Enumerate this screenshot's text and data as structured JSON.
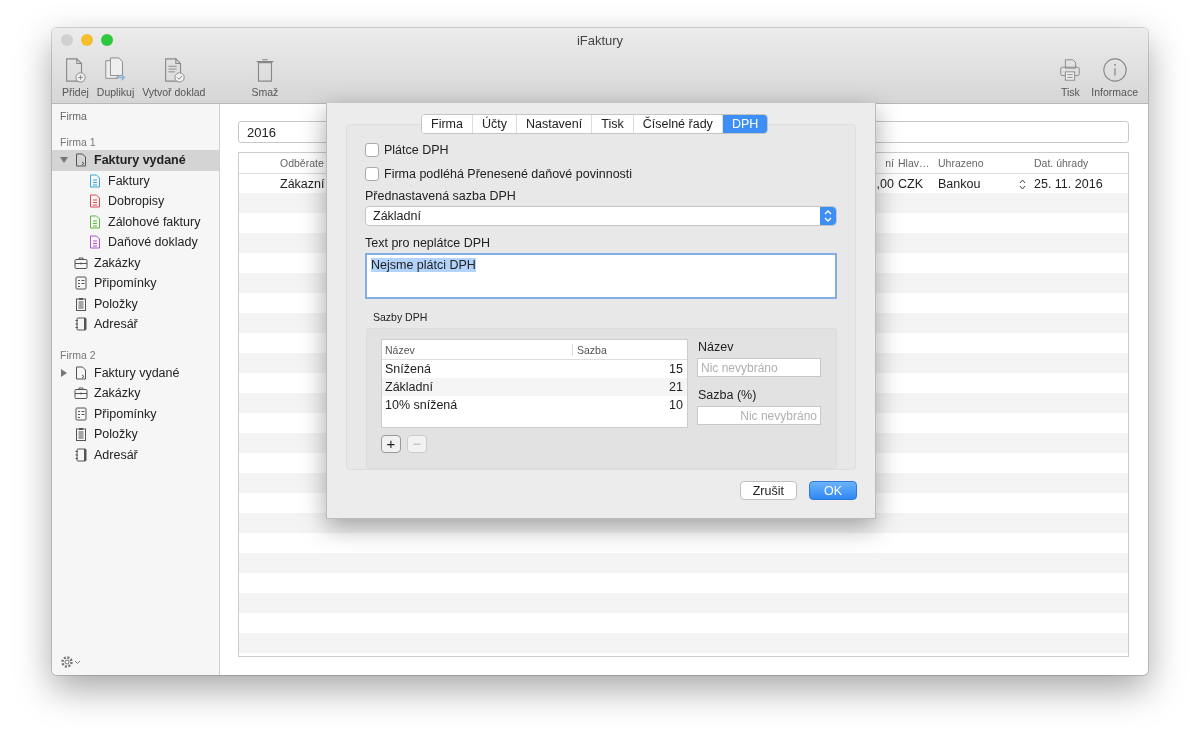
{
  "window": {
    "title": "iFaktury"
  },
  "toolbar": {
    "left": [
      {
        "label": "Přidej",
        "kind": "add"
      },
      {
        "label": "Duplikuj",
        "kind": "duplicate"
      },
      {
        "label": "Vytvoř doklad",
        "kind": "create"
      },
      {
        "label": "Smaž",
        "kind": "delete"
      }
    ],
    "right": [
      {
        "label": "Tisk",
        "kind": "print"
      },
      {
        "label": "Informace",
        "kind": "info"
      }
    ]
  },
  "sidebar": {
    "header": "Firma",
    "groups": [
      {
        "title": "Firma 1",
        "items": [
          {
            "label": "Faktury vydané",
            "kind": "invoice",
            "selected": true,
            "expanded": true,
            "children": [
              {
                "label": "Faktury",
                "color": "#3aa6d8",
                "selected": false
              },
              {
                "label": "Dobropisy",
                "color": "#e0484a",
                "selected": false
              },
              {
                "label": "Zálohové faktury",
                "color": "#5cb83a",
                "selected": false
              },
              {
                "label": "Daňové doklady",
                "color": "#b44fd0",
                "selected": false
              }
            ]
          },
          {
            "label": "Zakázky",
            "kind": "briefcase",
            "selected": false
          },
          {
            "label": "Připomínky",
            "kind": "list",
            "selected": false
          },
          {
            "label": "Položky",
            "kind": "clipboard",
            "selected": false
          },
          {
            "label": "Adresář",
            "kind": "book",
            "selected": false
          }
        ]
      },
      {
        "title": "Firma 2",
        "items": [
          {
            "label": "Faktury vydané",
            "kind": "invoice",
            "selected": false,
            "expanded": false
          },
          {
            "label": "Zakázky",
            "kind": "briefcase",
            "selected": false
          },
          {
            "label": "Připomínky",
            "kind": "list",
            "selected": false
          },
          {
            "label": "Položky",
            "kind": "clipboard",
            "selected": false
          },
          {
            "label": "Adresář",
            "kind": "book",
            "selected": false
          }
        ]
      }
    ]
  },
  "search": {
    "value": "2016"
  },
  "table": {
    "columns": [
      {
        "label": "Odběrate",
        "kind": "left"
      },
      {
        "label": "ní",
        "kind": "right"
      },
      {
        "label": "Hlav…",
        "kind": "text"
      },
      {
        "label": "Uhrazeno",
        "kind": "popup"
      },
      {
        "label": "Dat. úhrady",
        "kind": "text"
      }
    ],
    "rows": [
      {
        "cells": [
          "Zákazní",
          ",00",
          "CZK",
          "Bankou",
          "25. 11. 2016"
        ]
      }
    ]
  },
  "dialog": {
    "tabs": [
      {
        "label": "Firma",
        "selected": false
      },
      {
        "label": "Účty",
        "selected": false
      },
      {
        "label": "Nastavení",
        "selected": false
      },
      {
        "label": "Tisk",
        "selected": false
      },
      {
        "label": "Číselné řady",
        "selected": false
      },
      {
        "label": "DPH",
        "selected": true
      }
    ],
    "checkboxes": [
      {
        "label": "Plátce DPH",
        "checked": false
      },
      {
        "label": "Firma podléhá Přenesené daňové povinnosti",
        "checked": false
      }
    ],
    "default_rate": {
      "label": "Přednastavená sazba DPH",
      "value": "Základní"
    },
    "non_payer_text": {
      "label": "Text pro neplátce DPH",
      "value": "Nejsme plátci DPH",
      "focused": true,
      "text_selected": true
    },
    "rates": {
      "title": "Sazby DPH",
      "columns": [
        "Název",
        "Sazba"
      ],
      "rows": [
        {
          "name": "Snížená",
          "rate": "15",
          "selected": false
        },
        {
          "name": "Základní",
          "rate": "21",
          "selected": false
        },
        {
          "name": "10% snížená",
          "rate": "10",
          "selected": false
        }
      ],
      "add": {
        "label": "+",
        "disabled": false
      },
      "remove": {
        "label": "−",
        "disabled": true
      },
      "fields": [
        {
          "label": "Název",
          "placeholder": "Nic nevybráno",
          "kind": "text"
        },
        {
          "label": "Sazba (%)",
          "placeholder": "Nic nevybráno",
          "kind": "number"
        }
      ]
    },
    "buttons": [
      {
        "label": "Zrušit",
        "kind": "default"
      },
      {
        "label": "OK",
        "kind": "primary"
      }
    ]
  }
}
